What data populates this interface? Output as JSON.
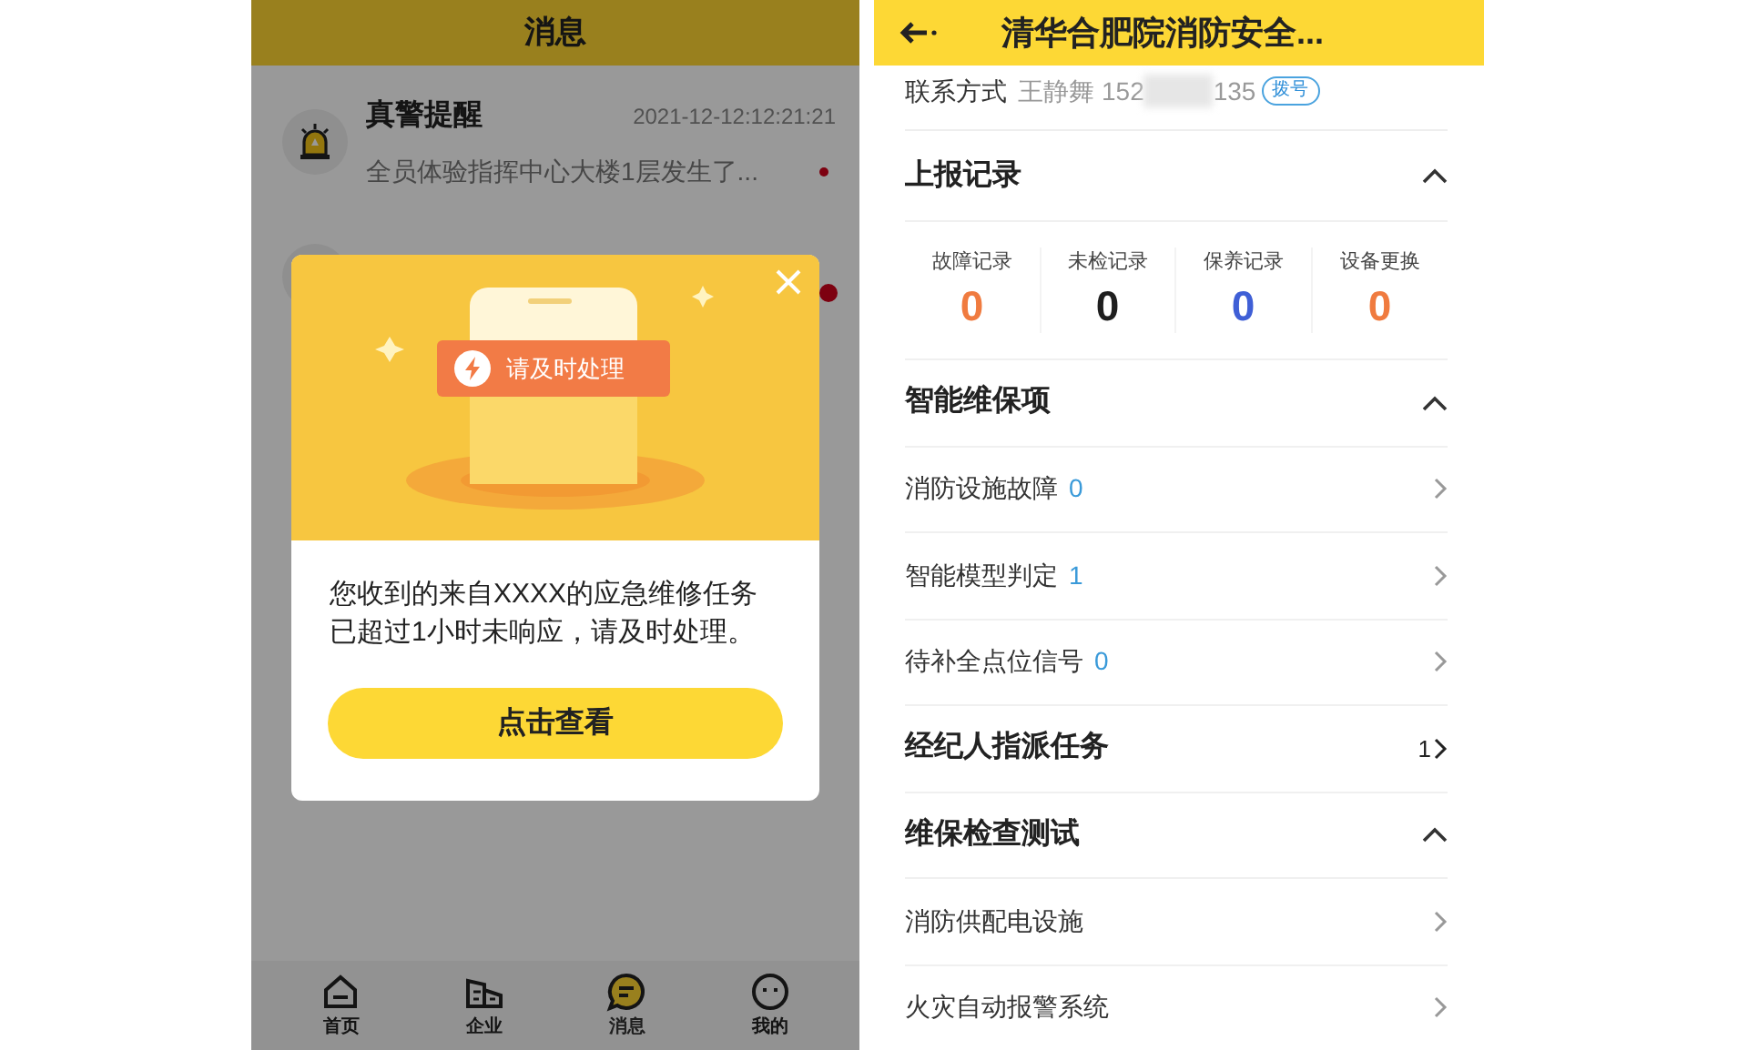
{
  "left_screen": {
    "header": {
      "title": "消息"
    },
    "messages": [
      {
        "title": "真警提醒",
        "time": "2021-12-12:12:21:21",
        "preview": "全员体验指挥中心大楼1层发生了...",
        "unread": true
      },
      {
        "unread": true
      }
    ],
    "dialog": {
      "badge": "请及时处理",
      "message": "您收到的来自XXXX的应急维修任务已超过1小时未响应，请及时处理。",
      "button": "点击查看"
    },
    "tab_bar": [
      {
        "kind": "home",
        "label": "首页",
        "selected": false
      },
      {
        "kind": "company",
        "label": "企业",
        "selected": false
      },
      {
        "kind": "messages",
        "label": "消息",
        "selected": true
      },
      {
        "kind": "profile",
        "label": "我的",
        "selected": false
      }
    ]
  },
  "right_screen": {
    "header": {
      "title": "清华合肥院消防安全..."
    },
    "contact": {
      "label": "联系方式",
      "name": "王静舞",
      "phone_start": "152",
      "phone_end": "135",
      "call_button": "拨号"
    },
    "sections": [
      {
        "kind": "stats",
        "title": "上报记录",
        "expanded": true,
        "stats": [
          {
            "label": "故障记录",
            "value": "0",
            "color": "#f07b3f"
          },
          {
            "label": "未检记录",
            "value": "0",
            "color": "#1f1f1f"
          },
          {
            "label": "保养记录",
            "value": "0",
            "color": "#3f5fd6"
          },
          {
            "label": "设备更换",
            "value": "0",
            "color": "#f07b3f"
          }
        ]
      },
      {
        "kind": "list",
        "title": "智能维保项",
        "expanded": true,
        "items": [
          {
            "label": "消防设施故障",
            "count": "0"
          },
          {
            "label": "智能模型判定",
            "count": "1"
          },
          {
            "label": "待补全点位信号",
            "count": "0"
          }
        ]
      },
      {
        "kind": "link",
        "title": "经纪人指派任务",
        "count": "1"
      },
      {
        "kind": "list",
        "title": "维保检查测试",
        "expanded": true,
        "items": [
          {
            "label": "消防供配电设施"
          },
          {
            "label": "火灾自动报警系统"
          }
        ]
      }
    ]
  }
}
